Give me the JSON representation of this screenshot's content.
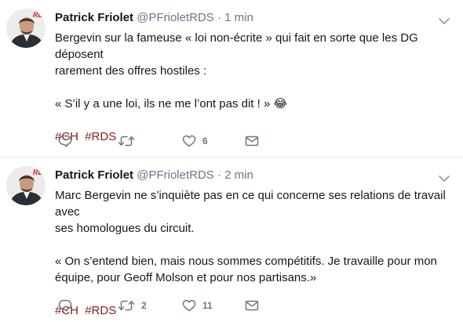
{
  "tweets": [
    {
      "author_name": "Patrick Friolet",
      "handle": "@PFrioletRDS",
      "separator": "·",
      "time": "1 min",
      "lines": [
        "Bergevin sur la fameuse « loi non-écrite » qui fait en sorte que les DG déposent",
        "rarement des offres hostiles :",
        "",
        "« S’il y a une loi, ils ne me l’ont pas dit ! » 😂",
        ""
      ],
      "hashtags": [
        "#CH",
        "#RDS"
      ],
      "reply_count": "",
      "retweet_count": "",
      "like_count": "6",
      "avatar_logo": "RDS"
    },
    {
      "author_name": "Patrick Friolet",
      "handle": "@PFrioletRDS",
      "separator": "·",
      "time": "2 min",
      "lines": [
        "Marc Bergevin ne s’inquiète pas en ce qui concerne ses relations de travail avec",
        "ses homologues du circuit.",
        "",
        "« On s’entend bien, mais nous sommes compétitifs. Je travaille pour mon",
        "équipe, pour Geoff Molson et pour nos partisans.»",
        ""
      ],
      "hashtags": [
        "#CH",
        "#RDS"
      ],
      "reply_count": "",
      "retweet_count": "2",
      "like_count": "11",
      "avatar_logo": "RDS"
    }
  ],
  "colors": {
    "hashtag": "#8a1b1b",
    "meta": "#657786",
    "text": "#14171a",
    "rds_red": "#d71920"
  }
}
